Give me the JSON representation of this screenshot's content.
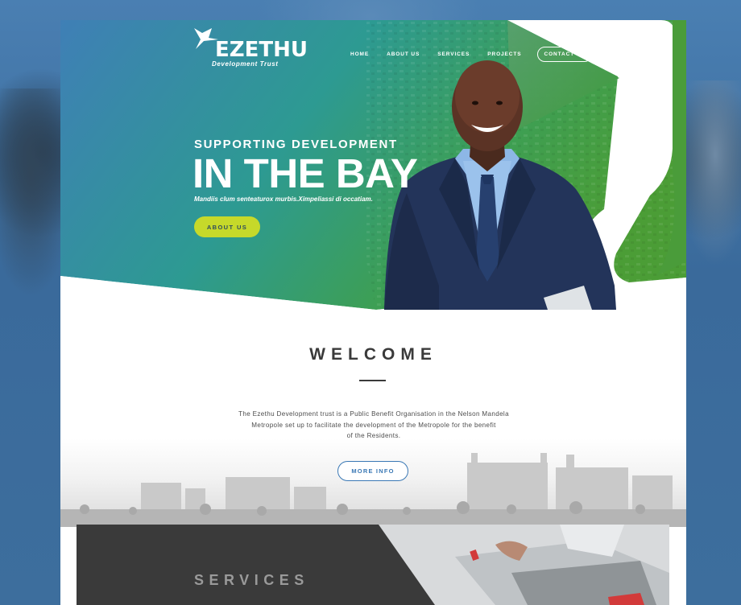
{
  "brand": {
    "name": "EZETHU",
    "tagline": "Development Trust"
  },
  "nav": {
    "items": [
      "HOME",
      "ABOUT US",
      "SERVICES",
      "PROJECTS"
    ],
    "contact_label": "CONTACT US"
  },
  "hero": {
    "kicker": "SUPPORTING DEVELOPMENT",
    "title": "IN THE BAY",
    "subtitle": "Mandiis clum senteaturox murbis.Ximpeliassi di occatiam.",
    "button_label": "ABOUT US"
  },
  "welcome": {
    "title": "WELCOME",
    "body_lines": [
      "The Ezethu Development trust is a Public Benefit Organisation in the Nelson Mandela",
      "Metropole set up to facilitate the development of the Metropole for the benefit",
      "of the Residents."
    ],
    "button_label": "MORE INFO"
  },
  "services": {
    "title": "SERVICES"
  },
  "colors": {
    "hero_gradient_start": "#3e84b4",
    "hero_gradient_mid": "#2f9f8a",
    "hero_gradient_end": "#4a9c3c",
    "accent_button": "#c6d92a",
    "link_blue": "#3a78b5",
    "dark_panel": "#3a3a3a"
  }
}
